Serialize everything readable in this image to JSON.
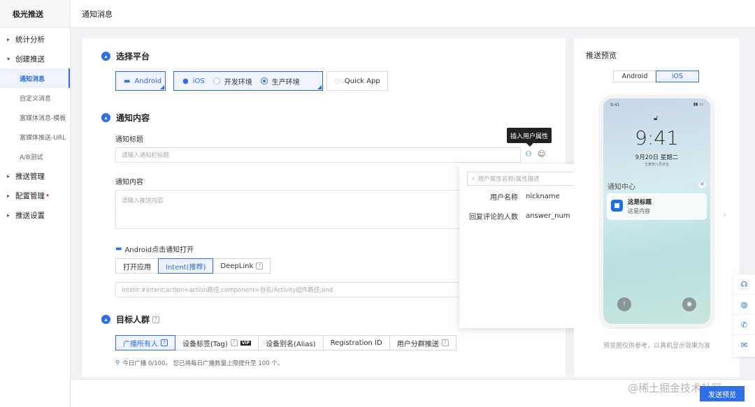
{
  "sidebar": {
    "brand": "极光推送",
    "items": [
      {
        "label": "统计分析",
        "caret": "▸"
      },
      {
        "label": "创建推送",
        "caret": "▾"
      },
      {
        "label": "推送管理",
        "caret": "▸"
      },
      {
        "label": "配置管理",
        "caret": "▸",
        "badge": "•"
      },
      {
        "label": "推送设置",
        "caret": "▸"
      }
    ],
    "sub": [
      "通知消息",
      "自定义消息",
      "富媒体消息-模板",
      "富媒体推送-URL",
      "A/B测试"
    ]
  },
  "header": {
    "title": "通知消息"
  },
  "platform": {
    "title": "选择平台",
    "android": "Android",
    "ios": "iOS",
    "env_dev": "开发环境",
    "env_prod": "生产环境",
    "quick_app": "Quick App"
  },
  "content": {
    "title": "通知内容",
    "title_label": "通知标题",
    "title_placeholder": "请输入通知栏标题",
    "body_label": "通知内容",
    "body_placeholder": "请输入推送内容",
    "android_open_label": "Android点击通知打开",
    "open_options": [
      "打开应用",
      "Intent(推荐)",
      "DeepLink"
    ],
    "intent_placeholder": "intent:#Intent;action=action路径;component=包名/Activity组件路径;end",
    "tooltip": "插入用户属性"
  },
  "attr_dropdown": {
    "search_placeholder": "用户属性名称/属性描述",
    "rows": [
      {
        "name": "用户名称",
        "key": "nickname"
      },
      {
        "name": "回复评论的人数",
        "key": "answer_num"
      }
    ]
  },
  "target": {
    "title": "目标人群",
    "options": [
      "广播所有人",
      "设备标签(Tag)",
      "设备别名(Alias)",
      "Registration ID",
      "用户分群推送"
    ],
    "vip": "VIP",
    "note": "今日广播 0/100。 您已将每日广播数量上限提升至 100 个。"
  },
  "preview": {
    "title": "推送预览",
    "tabs": [
      "Android",
      "iOS"
    ],
    "phone": {
      "status_time": "9:41",
      "clock": "9:41",
      "date": "9月20日 星期二",
      "sub": "壬寅年八月廿五",
      "center": "通知中心",
      "notif_title": "这是标题",
      "notif_body": "这是内容"
    },
    "note": "预览图仅供参考，以真机显示效果为准"
  },
  "footer": {
    "send_preview": "发送预览",
    "watermark": "@稀土掘金技术社区"
  },
  "colors": {
    "accent": "#2f6fe6"
  }
}
